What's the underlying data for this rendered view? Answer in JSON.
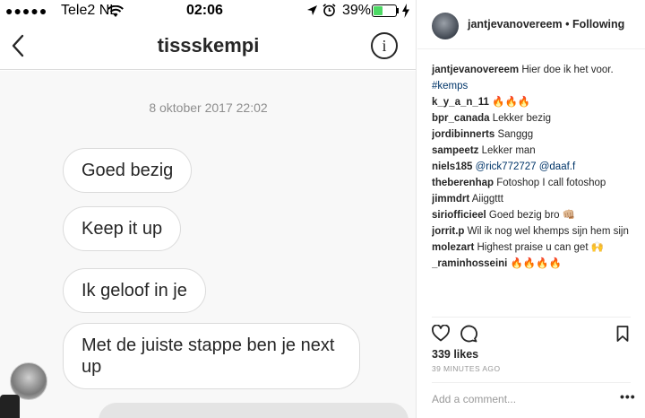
{
  "statusbar": {
    "signal_dots": "●●●●●",
    "carrier": "Tele2 NL",
    "time": "02:06",
    "battery_percent": "39%",
    "battery_level": 0.39
  },
  "dm": {
    "title": "tissskempi",
    "info_glyph": "i",
    "timestamp": "8 oktober 2017 22:02",
    "messages": [
      "Goed bezig",
      "Keep it up",
      "Ik geloof in je",
      "Met de juiste stappe ben je next up"
    ]
  },
  "post": {
    "author": "jantjevanovereem",
    "separator": "•",
    "follow_status": "Following",
    "caption": {
      "user": "jantjevanovereem",
      "text": "Hier doe ik het voor.",
      "hashtag": "#kemps"
    },
    "comments": [
      {
        "user": "k_y_a_n_11",
        "text": "🔥🔥🔥"
      },
      {
        "user": "bpr_canada",
        "text": "Lekker bezig"
      },
      {
        "user": "jordibinnerts",
        "text": "Sanggg"
      },
      {
        "user": "sampeetz",
        "text": "Lekker man"
      },
      {
        "user": "niels185",
        "text": "@rick772727 @daaf.f"
      },
      {
        "user": "theberenhap",
        "text": "Fotoshop I call fotoshop"
      },
      {
        "user": "jimmdrt",
        "text": "Aiiggttt"
      },
      {
        "user": "siriofficieel",
        "text": "Goed bezig bro 👊🏼"
      },
      {
        "user": "jorrit.p",
        "text": "Wil ik nog wel khemps sijn hem sijn"
      },
      {
        "user": "molezart",
        "text": "Highest praise u can get 🙌"
      },
      {
        "user": "_raminhosseini",
        "text": "🔥🔥🔥🔥"
      }
    ],
    "likes": "339 likes",
    "time_ago": "39 MINUTES AGO",
    "add_comment_placeholder": "Add a comment...",
    "more_glyph": "•••"
  },
  "icons": {
    "back": "chevron-left-icon",
    "info": "info-icon",
    "heart": "heart-icon",
    "comment": "comment-icon",
    "bookmark": "bookmark-icon",
    "wifi": "wifi-icon",
    "location": "location-arrow-icon",
    "alarm": "alarm-clock-icon",
    "charging": "charging-bolt-icon"
  },
  "colors": {
    "battery": "#4cd964",
    "link": "#003569",
    "muted": "#8e8e8e",
    "chat_bg": "#f8f8f8"
  }
}
